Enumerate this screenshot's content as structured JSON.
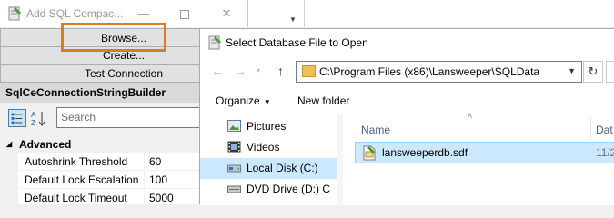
{
  "left_window": {
    "title": "Add SQL Compac...",
    "minimize_glyph": "—",
    "close_glyph": "✕",
    "buttons": {
      "browse": "Browse...",
      "create": "Create...",
      "test_connection": "Test Connection"
    },
    "highlight_color": "#e07a1f",
    "builder_header": "SqlCeConnectionStringBuilder",
    "search_placeholder": "Search",
    "property_grid": {
      "category": "Advanced",
      "rows": [
        {
          "name": "Autoshrink Threshold",
          "value": "60"
        },
        {
          "name": "Default Lock Escalation",
          "value": "100"
        },
        {
          "name": "Default Lock Timeout",
          "value": "5000"
        }
      ]
    }
  },
  "dialog": {
    "title": "Select Database File to Open",
    "nav": {
      "back_glyph": "←",
      "forward_glyph": "→",
      "up_glyph": "↑",
      "refresh_glyph": "↻",
      "address": "C:\\Program Files (x86)\\Lansweeper\\SQLData"
    },
    "toolbar": {
      "organize": "Organize",
      "new_folder": "New folder"
    },
    "nav_pane": [
      {
        "label": "Pictures",
        "icon": "pictures-icon"
      },
      {
        "label": "Videos",
        "icon": "videos-icon"
      },
      {
        "label": "Local Disk (C:)",
        "icon": "local-disk-icon"
      },
      {
        "label": "DVD Drive (D:) C",
        "icon": "dvd-drive-icon"
      }
    ],
    "columns": {
      "name": "Name",
      "date": "Dat"
    },
    "files": [
      {
        "name": "lansweeperdb.sdf",
        "date": "11/2"
      }
    ]
  }
}
